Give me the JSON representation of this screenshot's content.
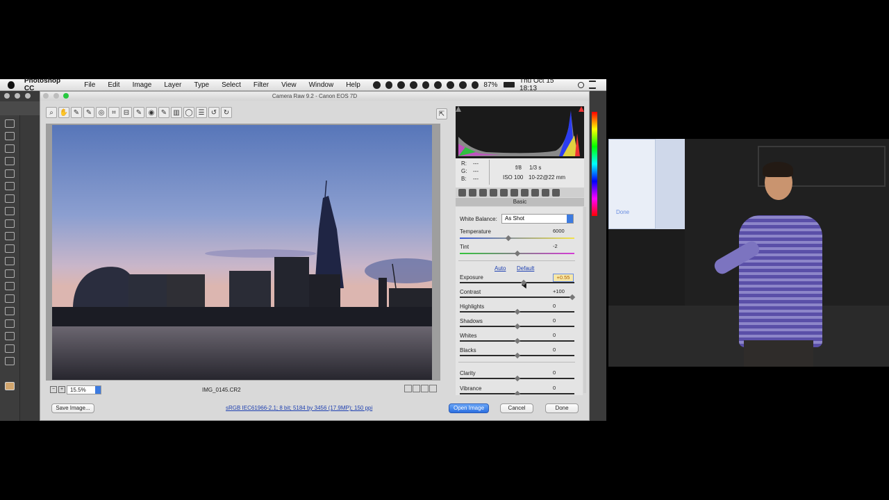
{
  "menubar": {
    "app_name": "Photoshop CC",
    "items": [
      "File",
      "Edit",
      "Image",
      "Layer",
      "Type",
      "Select",
      "Filter",
      "View",
      "Window",
      "Help"
    ],
    "battery": "87%",
    "clock": "Thu Oct 15  18:13"
  },
  "dialog": {
    "title": "Camera Raw 9.2  -  Canon EOS 7D",
    "filename": "IMG_0145.CR2",
    "zoom": "15.5%",
    "workflow_link": "sRGB IEC61966-2.1; 8 bit; 5184 by 3456 (17.9MP); 150 ppi",
    "save_button": "Save Image...",
    "open_button": "Open Image",
    "cancel_button": "Cancel",
    "done_button": "Done"
  },
  "info": {
    "r_label": "R:",
    "r_value": "---",
    "g_label": "G:",
    "g_value": "---",
    "b_label": "B:",
    "b_value": "---",
    "aperture": "f/8",
    "shutter": "1/3 s",
    "iso": "ISO 100",
    "lens": "10-22@22 mm"
  },
  "panel": {
    "name": "Basic",
    "white_balance_label": "White Balance:",
    "white_balance_value": "As Shot",
    "auto_link": "Auto",
    "default_link": "Default",
    "sliders": [
      {
        "label": "Temperature",
        "value": "6000",
        "pos": 0.42
      },
      {
        "label": "Tint",
        "value": "-2",
        "pos": 0.5
      },
      {
        "label": "Exposure",
        "value": "+0.55",
        "pos": 0.56
      },
      {
        "label": "Contrast",
        "value": "+100",
        "pos": 1.0
      },
      {
        "label": "Highlights",
        "value": "0",
        "pos": 0.5
      },
      {
        "label": "Shadows",
        "value": "0",
        "pos": 0.5
      },
      {
        "label": "Whites",
        "value": "0",
        "pos": 0.5
      },
      {
        "label": "Blacks",
        "value": "0",
        "pos": 0.5
      },
      {
        "label": "Clarity",
        "value": "0",
        "pos": 0.5
      },
      {
        "label": "Vibrance",
        "value": "0",
        "pos": 0.5
      }
    ]
  },
  "video": {
    "slide_text": "Done"
  }
}
